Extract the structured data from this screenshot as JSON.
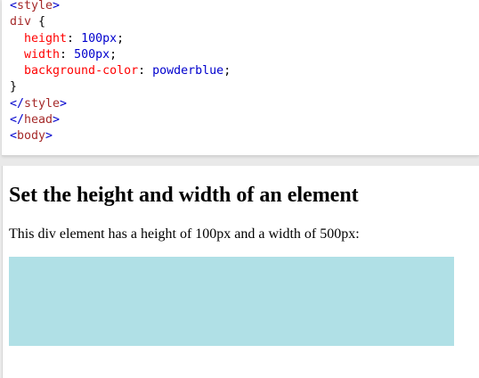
{
  "code_editor": {
    "lines": [
      [
        {
          "t": "<",
          "c": "tagbracket"
        },
        {
          "t": "style",
          "c": "tag"
        },
        {
          "t": ">",
          "c": "tagbracket"
        }
      ],
      [
        {
          "t": "div",
          "c": "sel"
        },
        {
          "t": " {",
          "c": "punc"
        }
      ],
      [
        {
          "t": "  height",
          "c": "prop"
        },
        {
          "t": ": ",
          "c": "punc"
        },
        {
          "t": "100px",
          "c": "val"
        },
        {
          "t": ";",
          "c": "punc"
        }
      ],
      [
        {
          "t": "  width",
          "c": "prop"
        },
        {
          "t": ": ",
          "c": "punc"
        },
        {
          "t": "500px",
          "c": "val"
        },
        {
          "t": ";",
          "c": "punc"
        }
      ],
      [
        {
          "t": "  background-color",
          "c": "prop"
        },
        {
          "t": ": ",
          "c": "punc"
        },
        {
          "t": "powderblue",
          "c": "val"
        },
        {
          "t": ";",
          "c": "punc"
        }
      ],
      [
        {
          "t": "}",
          "c": "punc"
        }
      ],
      [
        {
          "t": "</",
          "c": "tagbracket"
        },
        {
          "t": "style",
          "c": "tag"
        },
        {
          "t": ">",
          "c": "tagbracket"
        }
      ],
      [
        {
          "t": "</",
          "c": "tagbracket"
        },
        {
          "t": "head",
          "c": "tag"
        },
        {
          "t": ">",
          "c": "tagbracket"
        }
      ],
      [
        {
          "t": "<",
          "c": "tagbracket"
        },
        {
          "t": "body",
          "c": "tag"
        },
        {
          "t": ">",
          "c": "tagbracket"
        }
      ]
    ]
  },
  "result": {
    "heading": "Set the height and width of an element",
    "paragraph": "This div element has a height of 100px and a width of 500px:",
    "box_color": "#b0e0e6"
  }
}
